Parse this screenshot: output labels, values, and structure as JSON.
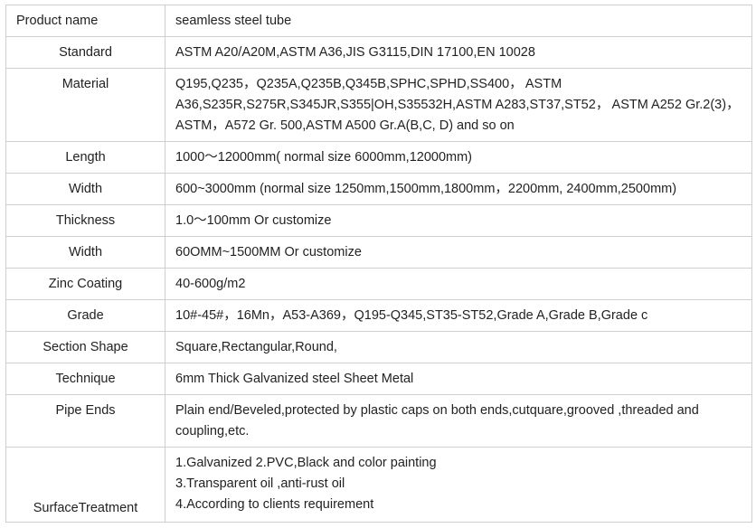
{
  "table": {
    "header": {
      "label": "Product name",
      "value": "seamless steel tube"
    },
    "rows": [
      {
        "label": "Standard",
        "value": "ASTM A20/A20M,ASTM A36,JIS G3115,DIN 17100,EN 10028"
      },
      {
        "label": "Material",
        "lines": [
          "Q195,Q235，Q235A,Q235B,Q345B,SPHC,SPHD,SS400， ASTM",
          "A36,S235R,S275R,S345JR,S355|OH,S35532H,ASTM A283,ST37,ST52， ASTM A252 Gr.2(3)，",
          "ASTM，A572 Gr. 500,ASTM A500 Gr.A(B,C, D) and so on"
        ]
      },
      {
        "label": "Length",
        "value": "1000～12000mm( normal size 6000mm,12000mm)"
      },
      {
        "label": "Width",
        "value": "600~3000mm (normal size 1250mm,1500mm,1800mm，2200mm, 2400mm,2500mm)"
      },
      {
        "label": "Thickness",
        "value": "1.0～100mm Or customize"
      },
      {
        "label": "Width",
        "value": "60OMM~1500MM Or customize"
      },
      {
        "label": "Zinc Coating",
        "value": "40-600g/m2"
      },
      {
        "label": "Grade",
        "value": "10#-45#，16Mn，A53-A369，Q195-Q345,ST35-ST52,Grade A,Grade B,Grade c"
      },
      {
        "label": "Section Shape",
        "value": "Square,Rectangular,Round,"
      },
      {
        "label": "Technique",
        "value": "6mm Thick Galvanized steel Sheet Metal"
      },
      {
        "label": "Pipe Ends",
        "lines": [
          "Plain end/Beveled,protected by plastic caps on both ends,cutquare,grooved ,threaded and",
          "coupling,etc."
        ]
      },
      {
        "label": "SurfaceTreatment",
        "lines": [
          "1.Galvanized 2.PVC,Black and color painting",
          "3.Transparent oil ,anti-rust oil",
          "4.According to clients requirement"
        ]
      }
    ]
  }
}
